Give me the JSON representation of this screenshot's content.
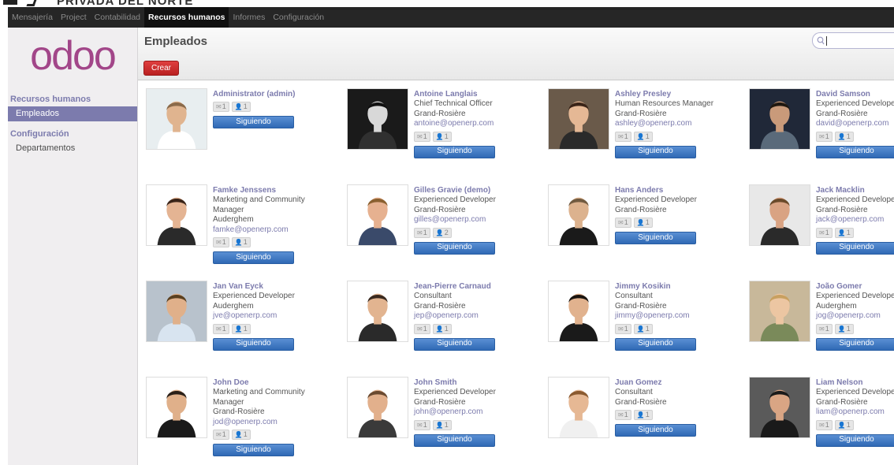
{
  "banner": {
    "text": "PRIVADA DEL NORTE"
  },
  "menu": [
    "Mensajería",
    "Project",
    "Contabilidad",
    "Recursos humanos",
    "Informes",
    "Configuración"
  ],
  "menu_active": 3,
  "logo": "odoo",
  "sidebar": {
    "section1": "Recursos humanos",
    "item1": "Empleados",
    "section2": "Configuración",
    "item2": "Departamentos"
  },
  "header": {
    "title": "Empleados",
    "create_label": "Crear",
    "search_value": ""
  },
  "follow_label": "Siguiendo",
  "employees": [
    {
      "name": "Administrator (admin)",
      "job": "",
      "addr": "",
      "email": "",
      "msg": "1",
      "fol": "1"
    },
    {
      "name": "Antoine Langlais",
      "job": "Chief Technical Officer",
      "addr": "Grand-Rosière",
      "email": "antoine@openerp.com",
      "msg": "1",
      "fol": "1"
    },
    {
      "name": "Ashley Presley",
      "job": "Human Resources Manager",
      "addr": "Grand-Rosière",
      "email": "ashley@openerp.com",
      "msg": "1",
      "fol": "1"
    },
    {
      "name": "David Samson",
      "job": "Experienced Develope",
      "addr": "Grand-Rosière",
      "email": "david@openerp.com",
      "msg": "1",
      "fol": "1"
    },
    {
      "name": "Famke Jenssens",
      "job": "Marketing and Community",
      "job2": "Manager",
      "addr": "Auderghem",
      "email": "famke@openerp.com",
      "msg": "1",
      "fol": "1"
    },
    {
      "name": "Gilles Gravie (demo)",
      "job": "Experienced Developer",
      "addr": "Grand-Rosière",
      "email": "gilles@openerp.com",
      "msg": "1",
      "fol": "2"
    },
    {
      "name": "Hans Anders",
      "job": "Experienced Developer",
      "addr": "Grand-Rosière",
      "email": "",
      "msg": "1",
      "fol": "1"
    },
    {
      "name": "Jack Macklin",
      "job": "Experienced Develope",
      "addr": "Grand-Rosière",
      "email": "jack@openerp.com",
      "msg": "1",
      "fol": "1"
    },
    {
      "name": "Jan Van Eyck",
      "job": "Experienced Developer",
      "addr": "Auderghem",
      "email": "jve@openerp.com",
      "msg": "1",
      "fol": "1"
    },
    {
      "name": "Jean-Pierre Carnaud",
      "job": "Consultant",
      "addr": "Grand-Rosière",
      "email": "jep@openerp.com",
      "msg": "1",
      "fol": "1"
    },
    {
      "name": "Jimmy Kosikin",
      "job": "Consultant",
      "addr": "Grand-Rosière",
      "email": "jimmy@openerp.com",
      "msg": "1",
      "fol": "1"
    },
    {
      "name": "João Gomer",
      "job": "Experienced Develope",
      "addr": "Auderghem",
      "email": "jog@openerp.com",
      "msg": "1",
      "fol": "1"
    },
    {
      "name": "John Doe",
      "job": "Marketing and Community",
      "job2": "Manager",
      "addr": "Grand-Rosière",
      "email": "jod@openerp.com",
      "msg": "1",
      "fol": "1"
    },
    {
      "name": "John Smith",
      "job": "Experienced Developer",
      "addr": "Grand-Rosière",
      "email": "john@openerp.com",
      "msg": "1",
      "fol": "1"
    },
    {
      "name": "Juan Gomez",
      "job": "Consultant",
      "addr": "Grand-Rosière",
      "email": "",
      "msg": "1",
      "fol": "1"
    },
    {
      "name": "Liam Nelson",
      "job": "Experienced Develope",
      "addr": "Grand-Rosière",
      "email": "liam@openerp.com",
      "msg": "1",
      "fol": "1"
    }
  ],
  "photos": [
    {
      "bg": "#e8eef0",
      "skin": "#e0b48f",
      "hair": "#8a6a4a",
      "shirt": "#ffffff"
    },
    {
      "bg": "#1a1a1a",
      "skin": "#d8d8d8",
      "hair": "#101010",
      "shirt": "#303030"
    },
    {
      "bg": "#6a5a4a",
      "skin": "#e5b895",
      "hair": "#3a2418",
      "shirt": "#2a2a2a"
    },
    {
      "bg": "#202838",
      "skin": "#c99a7a",
      "hair": "#201810",
      "shirt": "#5a6a7a"
    },
    {
      "bg": "#ffffff",
      "skin": "#e4b493",
      "hair": "#3a2418",
      "shirt": "#2a2a2a"
    },
    {
      "bg": "#ffffff",
      "skin": "#e6b190",
      "hair": "#8a6030",
      "shirt": "#3a4a6a"
    },
    {
      "bg": "#ffffff",
      "skin": "#dcb28e",
      "hair": "#705a40",
      "shirt": "#1a1a1a"
    },
    {
      "bg": "#e8e8e8",
      "skin": "#d9a383",
      "hair": "#6a4a2a",
      "shirt": "#2a2a2a"
    },
    {
      "bg": "#b8c2cc",
      "skin": "#e0b08a",
      "hair": "#5a4020",
      "shirt": "#d8e4f0"
    },
    {
      "bg": "#ffffff",
      "skin": "#e2b490",
      "hair": "#3a2a20",
      "shirt": "#2a2a2a"
    },
    {
      "bg": "#ffffff",
      "skin": "#e1b28e",
      "hair": "#1a1410",
      "shirt": "#1a1a1a"
    },
    {
      "bg": "#c8b89a",
      "skin": "#ecc6a2",
      "hair": "#c8a060",
      "shirt": "#7a8a5a"
    },
    {
      "bg": "#ffffff",
      "skin": "#e0b08a",
      "hair": "#2a2018",
      "shirt": "#1a1a1a"
    },
    {
      "bg": "#ffffff",
      "skin": "#e2b08c",
      "hair": "#6a4a30",
      "shirt": "#3a3a3a"
    },
    {
      "bg": "#ffffff",
      "skin": "#e6b894",
      "hair": "#8a5a30",
      "shirt": "#f0f0f0"
    },
    {
      "bg": "#5a5a5a",
      "skin": "#d9a584",
      "hair": "#1a1a1a",
      "shirt": "#1a1a1a"
    }
  ]
}
